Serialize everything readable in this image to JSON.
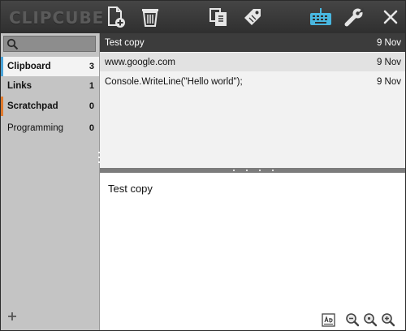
{
  "app": {
    "logo_text": "CLIPCUBE"
  },
  "toolbar": {
    "icons": [
      "new-clip-icon",
      "trash-icon",
      "copy-icon",
      "tag-icon",
      "keyboard-icon",
      "wrench-icon",
      "close-icon"
    ],
    "accent": "#49b7e0"
  },
  "sidebar": {
    "search": {
      "value": "",
      "placeholder": ""
    },
    "categories": [
      {
        "label": "Clipboard",
        "count": "3",
        "bold": true,
        "stripe": "#4aa3d8"
      },
      {
        "label": "Links",
        "count": "1",
        "bold": true,
        "stripe": ""
      },
      {
        "label": "Scratchpad",
        "count": "0",
        "bold": true,
        "stripe": "#e07a2e"
      },
      {
        "label": "Programming",
        "count": "0",
        "bold": false,
        "stripe": ""
      }
    ],
    "active_index": 0
  },
  "list": {
    "items": [
      {
        "text": "Test copy",
        "date": "9 Nov"
      },
      {
        "text": "www.google.com",
        "date": "9 Nov"
      },
      {
        "text": "Console.WriteLine(\"Hello world\");",
        "date": "9 Nov"
      }
    ],
    "selected_index": 0
  },
  "preview": {
    "text": "Test copy",
    "tools": [
      "text-format-icon",
      "zoom-out-icon",
      "zoom-reset-icon",
      "zoom-in-icon"
    ]
  }
}
